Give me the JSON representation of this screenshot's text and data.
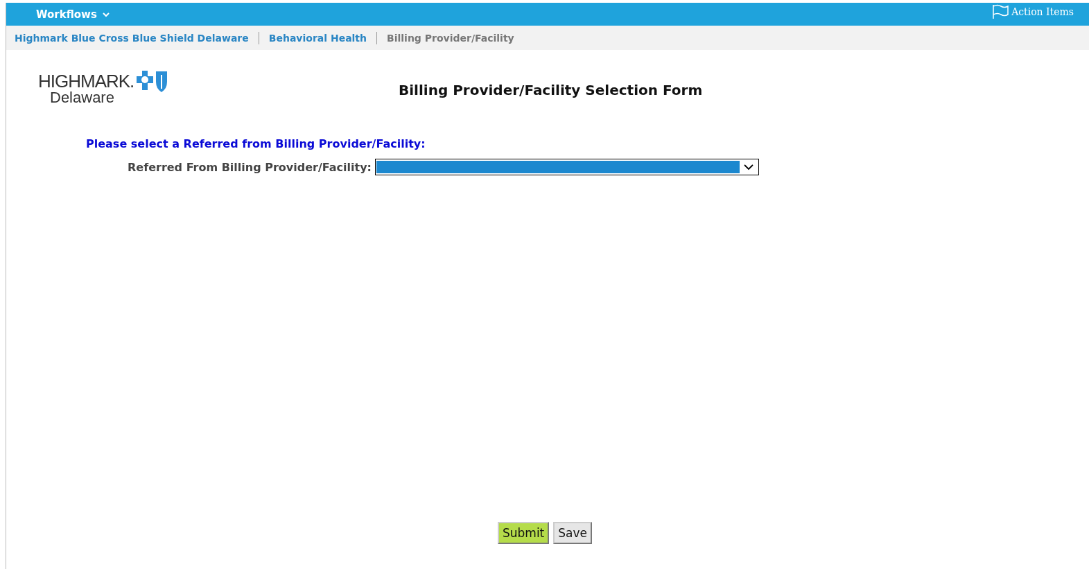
{
  "top_bar": {
    "menu": {
      "label": "Workflows",
      "expanded": false
    },
    "action_items": {
      "label": "Action Items"
    }
  },
  "breadcrumbs": [
    {
      "label": "Highmark Blue Cross Blue Shield Delaware",
      "selected": false
    },
    {
      "label": "Behavioral Health",
      "selected": false
    },
    {
      "label": "Billing Provider/Facility",
      "selected": true
    }
  ],
  "logo": {
    "wordmark": "HIGHMARK.",
    "region": "Delaware"
  },
  "form": {
    "title": "Billing Provider/Facility Selection Form",
    "prompt": "Please select a Referred from Billing Provider/Facility:",
    "field_label": "Referred From Billing Provider/Facility:",
    "value_redacted": true
  },
  "buttons": [
    {
      "label": "Submit",
      "kind": "primary"
    },
    {
      "label": "Save",
      "kind": "secondary"
    }
  ]
}
